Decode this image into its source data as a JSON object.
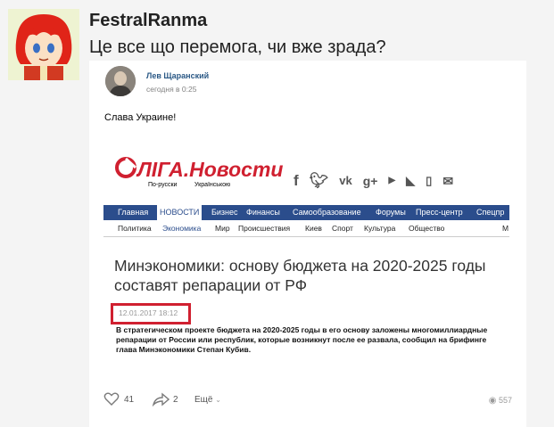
{
  "post": {
    "username": "FestralRanma",
    "text": "Це все що перемога, чи вже зрада?"
  },
  "repost": {
    "author": "Лев Щаранский",
    "time": "сегодня в 0:25",
    "text": "Слава Украине!"
  },
  "embed": {
    "logo_text": "ЛІГА.Новости",
    "lang_ru": "По-русски",
    "lang_ua": "Українською",
    "social_icons": [
      "facebook-icon",
      "twitter-icon",
      "vk-icon",
      "google-plus-icon",
      "youtube-icon",
      "rss-icon",
      "mobile-icon",
      "mail-icon"
    ],
    "menu_primary": [
      "Главная",
      "НОВОСТИ",
      "Бизнес",
      "Финансы",
      "Самообразование",
      "Форумы",
      "Пресс-центр",
      "Спецпр"
    ],
    "menu_secondary": [
      "Политика",
      "Экономика",
      "Мир",
      "Происшествия",
      "Киев",
      "Спорт",
      "Культура",
      "Общество",
      "М"
    ],
    "headline": "Минэкономики: основу бюджета на 2020-2025 годы составят репарации от РФ",
    "date": "12.01.2017 18:12",
    "lead": "В стратегическом проекте бюджета на 2020-2025 годы в его основу заложены многомиллиардные репарации от России или республик, которые возникнут после ее развала, сообщил на брифинге глава Минэкономики Степан Кубив."
  },
  "actions": {
    "likes": "41",
    "shares": "2",
    "more": "Ещё",
    "views": "557"
  },
  "colors": {
    "link": "#2a5885",
    "liga_red": "#d02030",
    "liga_blue": "#2b4d8c"
  }
}
